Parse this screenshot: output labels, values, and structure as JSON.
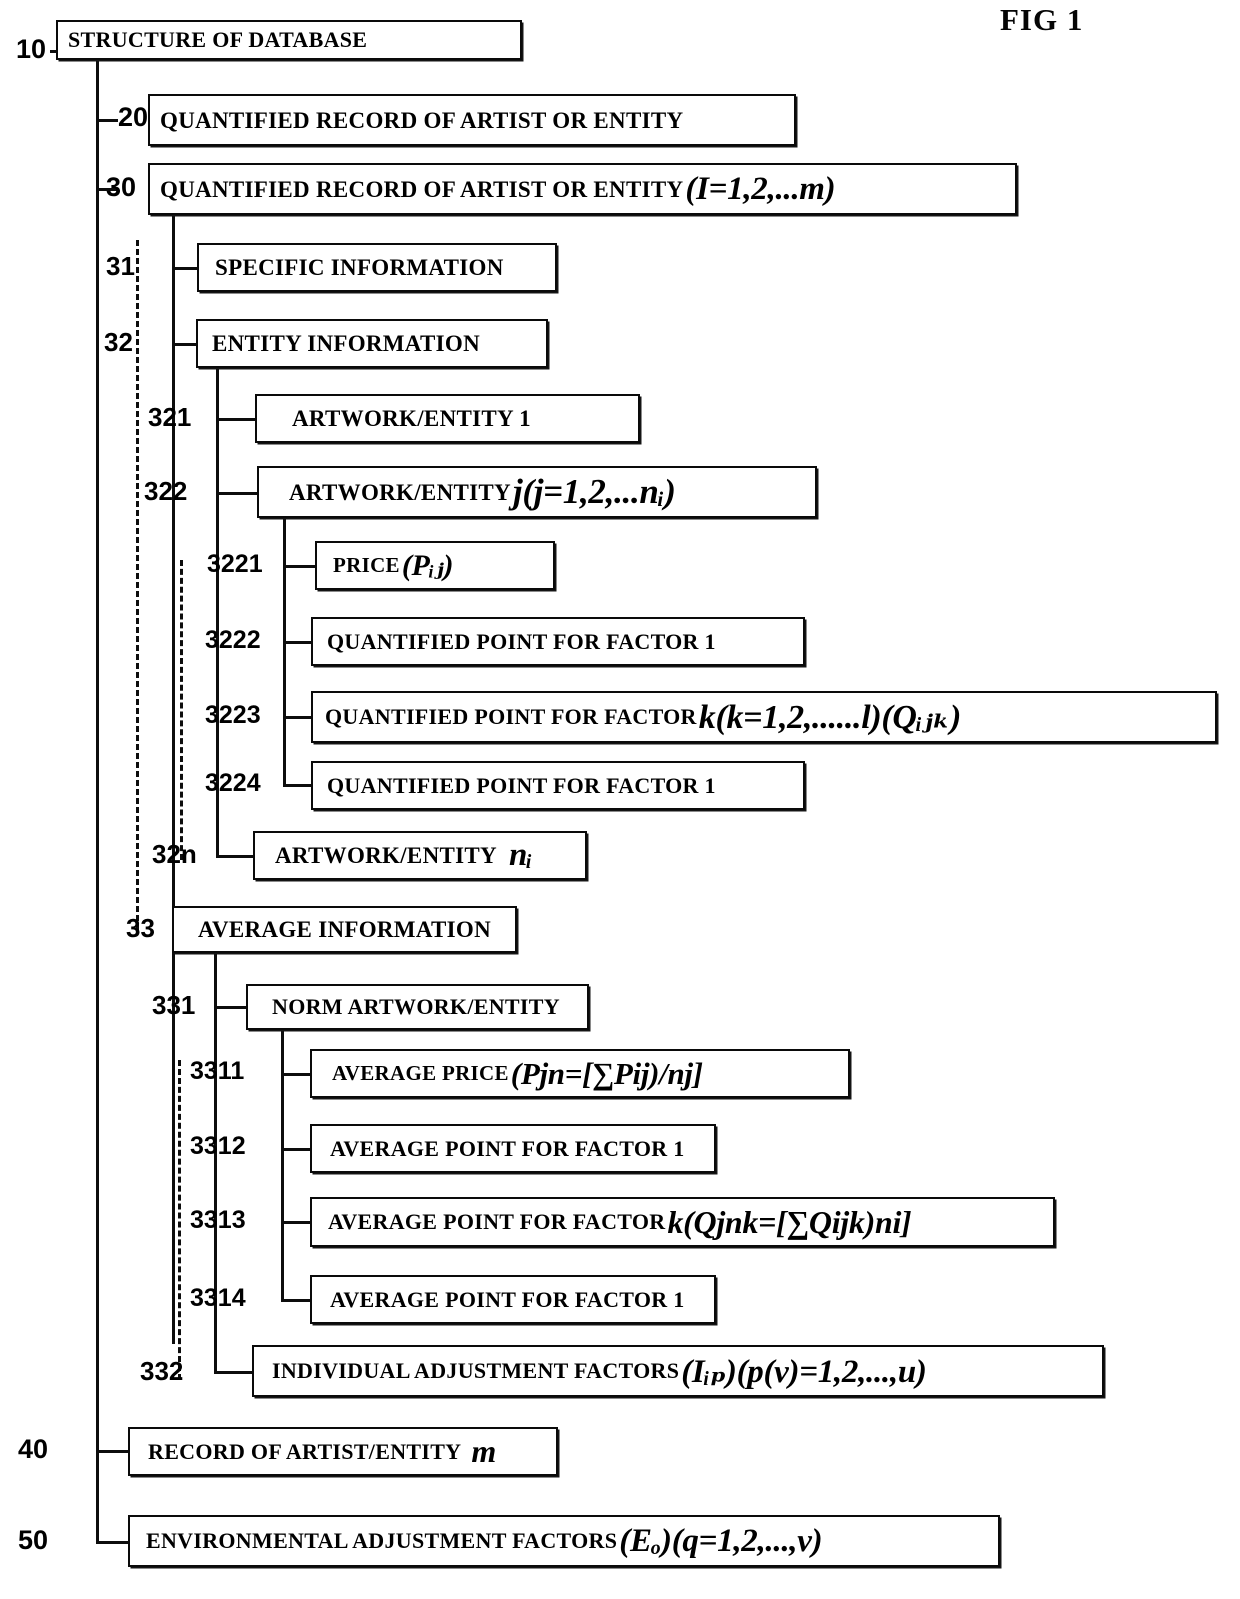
{
  "figure": {
    "title": "FIG 1"
  },
  "nodes": [
    {
      "ref": "10",
      "text": "STRUCTURE OF DATABASE",
      "math": ""
    },
    {
      "ref": "20",
      "text": "QUANTIFIED RECORD OF ARTIST OR ENTITY",
      "math": ""
    },
    {
      "ref": "30",
      "text": "QUANTIFIED RECORD OF ARTIST OR ENTITY",
      "math": "(I=1,2,...m)"
    },
    {
      "ref": "31",
      "text": "SPECIFIC INFORMATION",
      "math": ""
    },
    {
      "ref": "32",
      "text": "ENTITY INFORMATION",
      "math": ""
    },
    {
      "ref": "321",
      "text": "ARTWORK/ENTITY 1",
      "math": ""
    },
    {
      "ref": "322",
      "text": "ARTWORK/ENTITY",
      "math": "j(j=1,2,...nᵢ)"
    },
    {
      "ref": "3221",
      "text": "PRICE",
      "math": "(Pᵢⱼ)"
    },
    {
      "ref": "3222",
      "text": "QUANTIFIED POINT FOR FACTOR 1",
      "math": ""
    },
    {
      "ref": "3223",
      "text": "QUANTIFIED POINT FOR FACTOR",
      "math": "k(k=1,2,......l)(Qᵢⱼₖ)"
    },
    {
      "ref": "3224",
      "text": "QUANTIFIED POINT FOR FACTOR 1",
      "math": ""
    },
    {
      "ref": "32n",
      "text": "ARTWORK/ENTITY",
      "math": "nᵢ"
    },
    {
      "ref": "33",
      "text": "AVERAGE INFORMATION",
      "math": ""
    },
    {
      "ref": "331",
      "text": "NORM ARTWORK/ENTITY",
      "math": ""
    },
    {
      "ref": "3311",
      "text": "AVERAGE PRICE",
      "math": "(Pjn=[∑Pij)/nj]"
    },
    {
      "ref": "3312",
      "text": "AVERAGE POINT FOR FACTOR 1",
      "math": ""
    },
    {
      "ref": "3313",
      "text": "AVERAGE POINT FOR FACTOR",
      "math": "k(Qjnk=[∑Qijk)ni]"
    },
    {
      "ref": "3314",
      "text": "AVERAGE POINT FOR FACTOR 1",
      "math": ""
    },
    {
      "ref": "332",
      "text": "INDIVIDUAL ADJUSTMENT FACTORS",
      "math": "(Iᵢₚ)(p(v)=1,2,...,u)"
    },
    {
      "ref": "40",
      "text": "RECORD OF ARTIST/ENTITY",
      "math": "m"
    },
    {
      "ref": "50",
      "text": "ENVIRONMENTAL ADJUSTMENT FACTORS",
      "math": "(Eₒ)(q=1,2,...,v)"
    }
  ],
  "colors": {
    "ink": "#000000",
    "paper": "#ffffff"
  }
}
